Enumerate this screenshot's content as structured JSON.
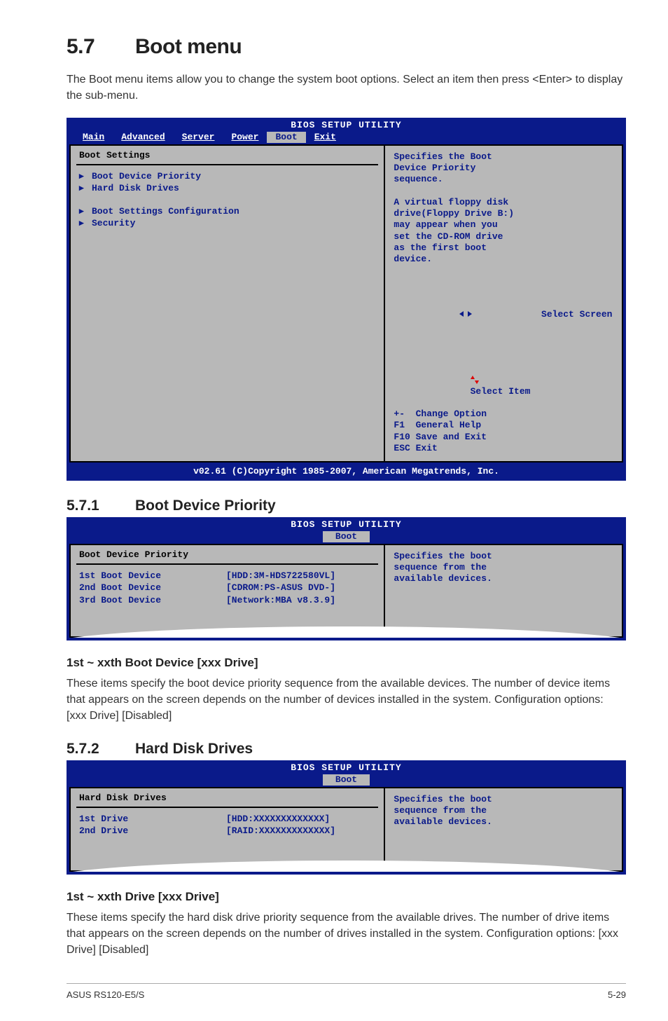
{
  "section_number": "5.7",
  "section_title": "Boot menu",
  "intro": "The Boot menu items allow you to change the system boot options. Select an item then press <Enter> to display the sub-menu.",
  "bios1": {
    "title": "BIOS SETUP UTILITY",
    "tabs": [
      "Main",
      "Advanced",
      "Server",
      "Power",
      "Boot",
      "Exit"
    ],
    "active_tab": "Boot",
    "heading": "Boot Settings",
    "items": [
      "Boot Device Priority",
      "Hard Disk Drives",
      "",
      "Boot Settings Configuration",
      "Security"
    ],
    "help_top": [
      "Specifies the Boot",
      "Device Priority",
      "sequence.",
      "",
      "A virtual floppy disk",
      "drive(Floppy Drive B:)",
      "may appear when you",
      "set the CD-ROM drive",
      "as the first boot",
      "device."
    ],
    "nav": {
      "select_screen": "Select Screen",
      "select_item": "Select Item",
      "change_option": "+-  Change Option",
      "general_help": "F1  General Help",
      "save_exit": "F10 Save and Exit",
      "esc_exit": "ESC Exit"
    },
    "footer": "v02.61 (C)Copyright 1985-2007, American Megatrends, Inc."
  },
  "sub1_number": "5.7.1",
  "sub1_title": "Boot Device Priority",
  "bios2": {
    "title": "BIOS SETUP UTILITY",
    "active_tab": "Boot",
    "heading": "Boot Device Priority",
    "rows": [
      {
        "k": "1st Boot Device",
        "v": "[HDD:3M-HDS722580VL]"
      },
      {
        "k": "2nd Boot Device",
        "v": "[CDROM:PS-ASUS DVD-]"
      },
      {
        "k": "3rd Boot Device",
        "v": "[Network:MBA v8.3.9]"
      }
    ],
    "help": [
      "Specifies the boot",
      "sequence from the",
      "available devices."
    ]
  },
  "sub1_h3": "1st ~ xxth Boot Device [xxx Drive]",
  "sub1_para": "These items specify the boot device priority sequence from the available devices. The number of device items that appears on the screen depends on the number of devices installed in the system. Configuration options: [xxx Drive] [Disabled]",
  "sub2_number": "5.7.2",
  "sub2_title": "Hard Disk Drives",
  "bios3": {
    "title": "BIOS SETUP UTILITY",
    "active_tab": "Boot",
    "heading": "Hard Disk Drives",
    "rows": [
      {
        "k": "1st Drive",
        "v": "[HDD:XXXXXXXXXXXXX]"
      },
      {
        "k": "2nd Drive",
        "v": "[RAID:XXXXXXXXXXXXX]"
      }
    ],
    "help": [
      "Specifies the boot",
      "sequence from the",
      "available devices."
    ]
  },
  "sub2_h3": "1st ~ xxth Drive [xxx Drive]",
  "sub2_para": "These items specify the hard disk drive priority sequence from the available drives. The number of drive items that appears on the screen depends on the number of drives installed in the system. Configuration options: [xxx Drive] [Disabled]",
  "footer_left": "ASUS RS120-E5/S",
  "footer_right": "5-29"
}
